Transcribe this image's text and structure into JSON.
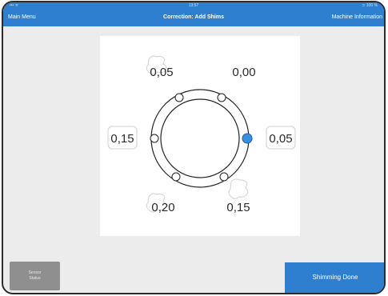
{
  "status_bar": {
    "left": "••• ᯤ",
    "time": "13:57",
    "right": "⊃ 100 %"
  },
  "navbar": {
    "left_label": "Main Menu",
    "title": "Correction: Add Shims",
    "right_label": "Machine Information"
  },
  "shims": {
    "top_left": "0,05",
    "top_right": "0,00",
    "left": "0,15",
    "right": "0,05",
    "bottom_left": "0,20",
    "bottom_right": "0,15",
    "active_foot": "right"
  },
  "colors": {
    "accent": "#2f7fd1",
    "active_foot": "#3b8fe0",
    "button_gray": "#8f8f8f"
  },
  "buttons": {
    "sensor_status_line1": "Sensor",
    "sensor_status_line2": "Status",
    "shimming_done": "Shimming Done"
  }
}
